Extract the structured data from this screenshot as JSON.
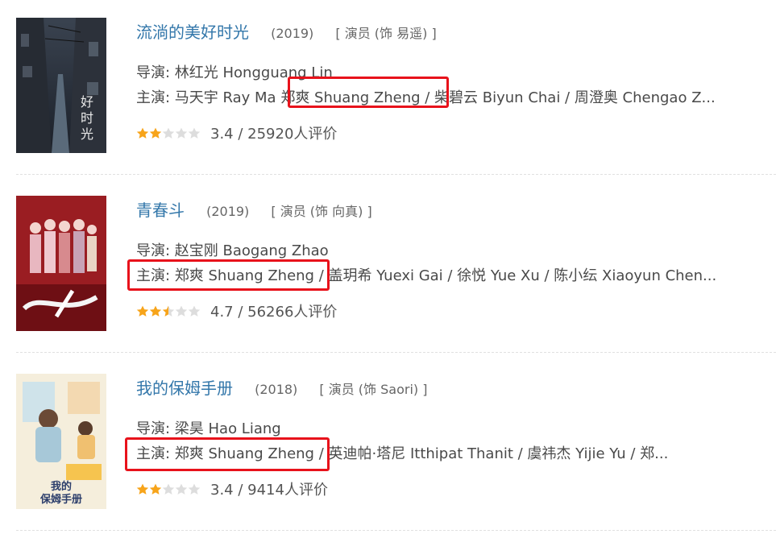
{
  "colors": {
    "accent": "#3377aa",
    "highlight": "#e8121b",
    "star": "#f7a41a",
    "star_empty": "#dddddd"
  },
  "works": [
    {
      "title": "流淌的美好时光",
      "year": "(2019)",
      "role": "[ 演员 (饰 易遥) ]",
      "director": "导演: 林红光 Hongguang Lin",
      "cast_prefix": "主演: 马天宇 Ray Ma",
      "cast_highlight": "郑爽 Shuang Zheng",
      "cast_rest": "/ 柴碧云 Biyun Chai / 周澄奥 Chengao Z...",
      "score": "3.4",
      "rating_text": "3.4 / 25920人评价",
      "stars": 2,
      "poster_icon": "movie-poster-alley"
    },
    {
      "title": "青春斗",
      "year": "(2019)",
      "role": "[ 演员 (饰 向真) ]",
      "director": "导演: 赵宝刚 Baogang Zhao",
      "cast_highlight": "主演: 郑爽 Shuang Zheng",
      "cast_rest": "/ 盖玥希 Yuexi Gai / 徐悦 Yue Xu / 陈小纭 Xiaoyun Chen...",
      "score": "4.7",
      "rating_text": "4.7 / 56266人评价",
      "stars": 2.5,
      "poster_icon": "movie-poster-group"
    },
    {
      "title": "我的保姆手册",
      "year": "(2018)",
      "role": "[ 演员 (饰 Saori) ]",
      "director": "导演: 梁昊 Hao Liang",
      "cast_highlight": "主演: 郑爽 Shuang Zheng",
      "cast_rest": "/ 英迪帕·塔尼 Itthipat Thanit / 虞祎杰 Yijie Yu / 郑...",
      "score": "3.4",
      "rating_text": "3.4 / 9414人评价",
      "stars": 2,
      "poster_icon": "movie-poster-illustrated",
      "poster_text": "我的保姆手册"
    }
  ]
}
